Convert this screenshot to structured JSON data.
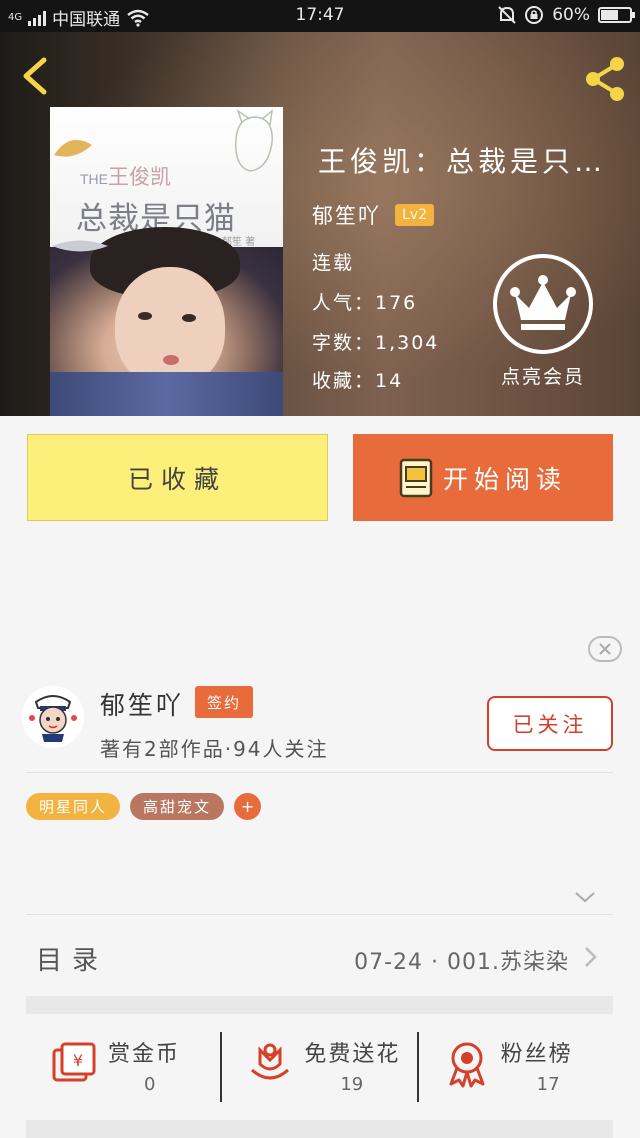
{
  "status_bar": {
    "network": "4G",
    "carrier": "中国联通",
    "time": "17:47",
    "battery": "60%",
    "battery_level": 0.6
  },
  "book": {
    "title": "王俊凯：总裁是只…",
    "author": "郁笙吖",
    "level": "Lv2",
    "status": "连载",
    "popularity": "人气：176",
    "word_count": "字数：1,304",
    "favorites": "收藏：14"
  },
  "cover": {
    "prefix": "THE",
    "line1": "王俊凯",
    "line2": "总裁是只猫",
    "author": "郁笙 著"
  },
  "vip": {
    "label": "点亮会员"
  },
  "buttons": {
    "collected": "已收藏",
    "start_reading": "开始阅读"
  },
  "author_card": {
    "name": "郁笙吖",
    "badge": "签约",
    "stats": "著有2部作品·94人关注",
    "follow": "已关注"
  },
  "tags": [
    {
      "label": "明星同人",
      "color": "#f2b341"
    },
    {
      "label": "高甜宠文",
      "color": "#b97762"
    }
  ],
  "tag_add": "+",
  "toc": {
    "label": "目录",
    "latest": "07-24 · 001.苏柒染"
  },
  "actions": [
    {
      "label": "赏金币",
      "count": "0",
      "icon": "red-envelope-icon"
    },
    {
      "label": "免费送花",
      "count": "19",
      "icon": "flower-icon"
    },
    {
      "label": "粉丝榜",
      "count": "17",
      "icon": "medal-icon"
    }
  ],
  "colors": {
    "accent": "#e86b3b",
    "collected_bg": "#fdf07a",
    "follow_border": "#d5402b"
  }
}
